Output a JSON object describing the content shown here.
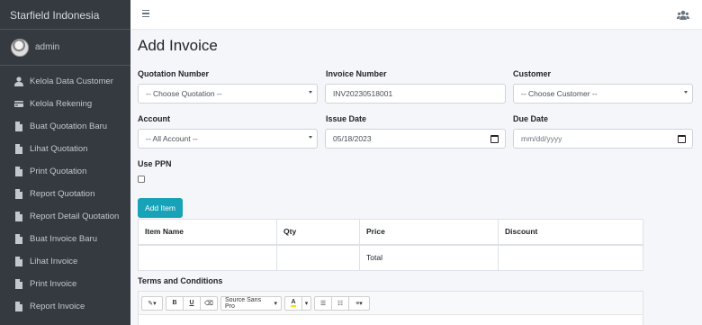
{
  "brand": "Starfield Indonesia",
  "user": {
    "name": "admin"
  },
  "sidebar": {
    "items": [
      {
        "label": "Kelola Data Customer",
        "icon": "user-icon"
      },
      {
        "label": "Kelola Rekening",
        "icon": "credit-card-icon"
      },
      {
        "label": "Buat Quotation Baru",
        "icon": "file-icon"
      },
      {
        "label": "Lihat Quotation",
        "icon": "file-icon"
      },
      {
        "label": "Print Quotation",
        "icon": "file-icon"
      },
      {
        "label": "Report Quotation",
        "icon": "file-icon"
      },
      {
        "label": "Report Detail Quotation",
        "icon": "file-icon"
      },
      {
        "label": "Buat Invoice Baru",
        "icon": "file-icon"
      },
      {
        "label": "Lihat Invoice",
        "icon": "file-icon"
      },
      {
        "label": "Print Invoice",
        "icon": "file-icon"
      },
      {
        "label": "Report Invoice",
        "icon": "file-icon"
      }
    ]
  },
  "page": {
    "title": "Add Invoice"
  },
  "form": {
    "quotation_label": "Quotation Number",
    "quotation_value": "-- Choose Quotation --",
    "invoice_label": "Invoice Number",
    "invoice_value": "INV20230518001",
    "customer_label": "Customer",
    "customer_value": "-- Choose Customer --",
    "account_label": "Account",
    "account_value": "-- All Account --",
    "issue_label": "Issue Date",
    "issue_value": "05/18/2023",
    "due_label": "Due Date",
    "due_placeholder": "mm/dd/yyyy",
    "ppn_label": "Use PPN",
    "ppn_checked": false,
    "add_item_label": "Add Item",
    "terms_label": "Terms and Conditions"
  },
  "table": {
    "headers": [
      "Item Name",
      "Qty",
      "Price",
      "Discount"
    ],
    "total_label": "Total"
  },
  "editor": {
    "font_name": "Source Sans Pro",
    "bold": "B",
    "underline": "U",
    "color_letter": "A"
  },
  "colors": {
    "sidebar_bg": "#343a40",
    "accent": "#17a2b8",
    "content_bg": "#f4f6f9"
  }
}
